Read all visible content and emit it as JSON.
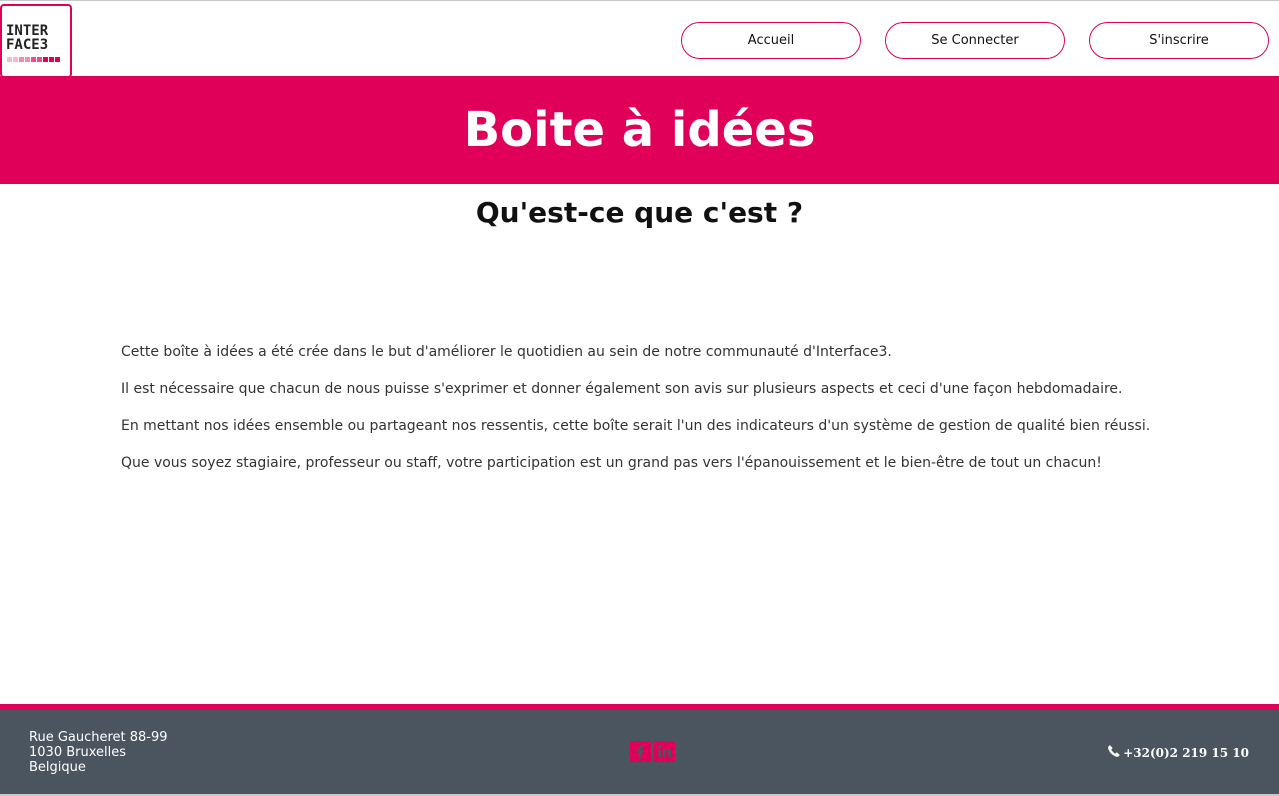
{
  "header": {
    "logo": {
      "line1": "INTER",
      "line2": "FACE3",
      "squares": [
        "#f4b8cf",
        "#f4b8cf",
        "#f48bb2",
        "#f48bb2",
        "#ea4d88",
        "#ea4d88",
        "#e0005a",
        "#e0005a",
        "#e0005a"
      ]
    },
    "nav": {
      "home": "Accueil",
      "login": "Se Connecter",
      "register": "S'inscrire"
    }
  },
  "banner": {
    "title": "Boite à idées"
  },
  "main": {
    "subtitle": "Qu'est-ce que c'est ?",
    "paragraphs": [
      "Cette boîte à idées a été crée dans le but d'améliorer le quotidien au sein de notre communauté d'Interface3.",
      "Il est nécessaire que chacun de nous puisse s'exprimer et donner également son avis sur plusieurs aspects et ceci d'une façon hebdomadaire.",
      "En mettant nos idées ensemble ou partageant nos ressentis, cette boîte serait l'un des indicateurs d'un système de gestion de qualité bien réussi.",
      "Que vous soyez stagiaire, professeur ou staff, votre participation est un grand pas vers l'épanouissement et le bien-être de tout un chacun!"
    ]
  },
  "footer": {
    "address": {
      "street": "Rue Gaucheret 88-99",
      "city": "1030 Bruxelles",
      "country": "Belgique"
    },
    "socials": {
      "facebook_icon": "facebook-icon",
      "linkedin_icon": "linkedin-icon"
    },
    "phone": "+32(0)2 219 15 10"
  },
  "colors": {
    "accent": "#e0005a",
    "footer_bg": "#4a5560",
    "text": "#333333"
  }
}
